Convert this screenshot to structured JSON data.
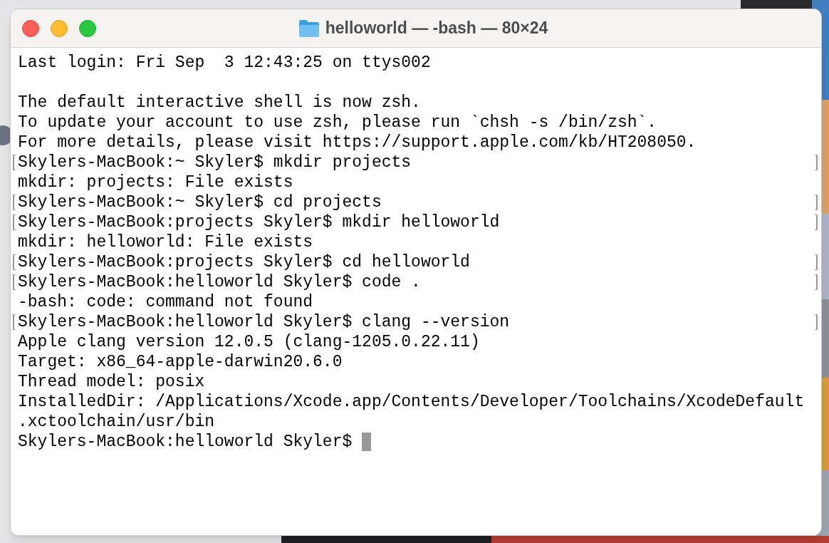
{
  "window": {
    "title": "helloworld — -bash — 80×24"
  },
  "terminal": {
    "lines": [
      {
        "text": "Last login: Fri Sep  3 12:43:25 on ttys002",
        "marked": false
      },
      {
        "marked": false
      },
      {
        "text": "The default interactive shell is now zsh.",
        "marked": false
      },
      {
        "text": "To update your account to use zsh, please run `chsh -s /bin/zsh`.",
        "marked": false
      },
      {
        "text": "For more details, please visit https://support.apple.com/kb/HT208050.",
        "marked": false
      },
      {
        "text": "Skylers-MacBook:~ Skyler$ mkdir projects",
        "marked": true
      },
      {
        "text": "mkdir: projects: File exists",
        "marked": false
      },
      {
        "text": "Skylers-MacBook:~ Skyler$ cd projects",
        "marked": true
      },
      {
        "text": "Skylers-MacBook:projects Skyler$ mkdir helloworld",
        "marked": true
      },
      {
        "text": "mkdir: helloworld: File exists",
        "marked": false
      },
      {
        "text": "Skylers-MacBook:projects Skyler$ cd helloworld",
        "marked": true
      },
      {
        "text": "Skylers-MacBook:helloworld Skyler$ code .",
        "marked": true
      },
      {
        "text": "-bash: code: command not found",
        "marked": false
      },
      {
        "text": "Skylers-MacBook:helloworld Skyler$ clang --version",
        "marked": true
      },
      {
        "text": "Apple clang version 12.0.5 (clang-1205.0.22.11)",
        "marked": false
      },
      {
        "text": "Target: x86_64-apple-darwin20.6.0",
        "marked": false
      },
      {
        "text": "Thread model: posix",
        "marked": false
      },
      {
        "text": "InstalledDir: /Applications/Xcode.app/Contents/Developer/Toolchains/XcodeDefault",
        "marked": false
      },
      {
        "text": ".xctoolchain/usr/bin",
        "marked": false
      },
      {
        "text": "Skylers-MacBook:helloworld Skyler$ ",
        "marked": false,
        "cursor": true
      }
    ]
  }
}
